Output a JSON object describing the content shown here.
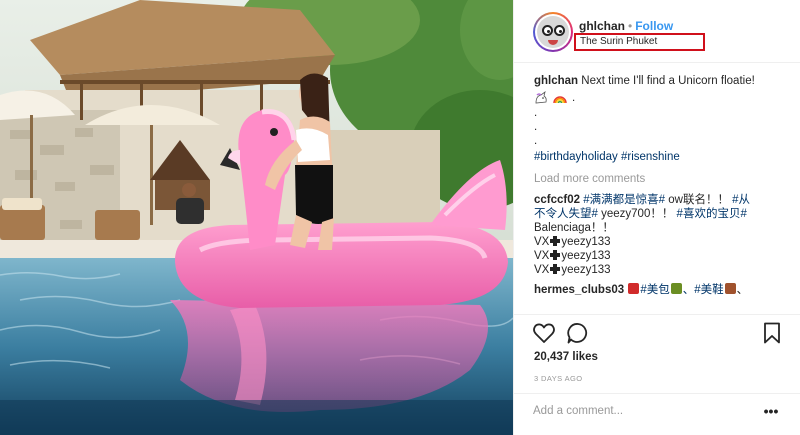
{
  "post": {
    "username": "ghlchan",
    "follow_label": "Follow",
    "separator": "•",
    "location": "The Surin Phuket"
  },
  "caption": {
    "username": "ghlchan",
    "text": "Next time I'll find a Unicorn floatie!",
    "emoji_icons": [
      "unicorn-emoji-icon",
      "rainbow-emoji-icon"
    ],
    "emoji_trail": ".",
    "dots": [
      ".",
      ".",
      "."
    ],
    "hashtags": [
      "#birthdayholiday",
      "#risenshine"
    ]
  },
  "load_more_label": "Load more comments",
  "comments": [
    {
      "username": "ccfccf02",
      "line1_tag1": "#满满都是惊喜#",
      "line1_text": "ow联名！！",
      "line1_tag2": "#从",
      "line2_tag": "不令人失望#",
      "line2_mid": "yeezy700！！",
      "line2_tag2": "#喜欢的宝贝#",
      "line3": "Balenciaga！！",
      "vx_lines": [
        "VX",
        "yeezy133"
      ],
      "vx_count": 3
    },
    {
      "username": "hermes_clubs03",
      "text_a": "#美包",
      "text_b": "、#美鞋",
      "text_c": "、",
      "line2": "、、"
    }
  ],
  "likes": "20,437 likes",
  "time_ago": "3 DAYS AGO",
  "add_comment_placeholder": "Add a comment...",
  "more_label": "•••",
  "colors": {
    "link": "#3897f0",
    "hashtag": "#003569",
    "highlight_box": "#d0101b",
    "muted": "#999999"
  },
  "icons": {
    "like": "heart-outline-icon",
    "comment": "speech-bubble-icon",
    "save": "bookmark-icon",
    "options": "more-options-icon"
  }
}
